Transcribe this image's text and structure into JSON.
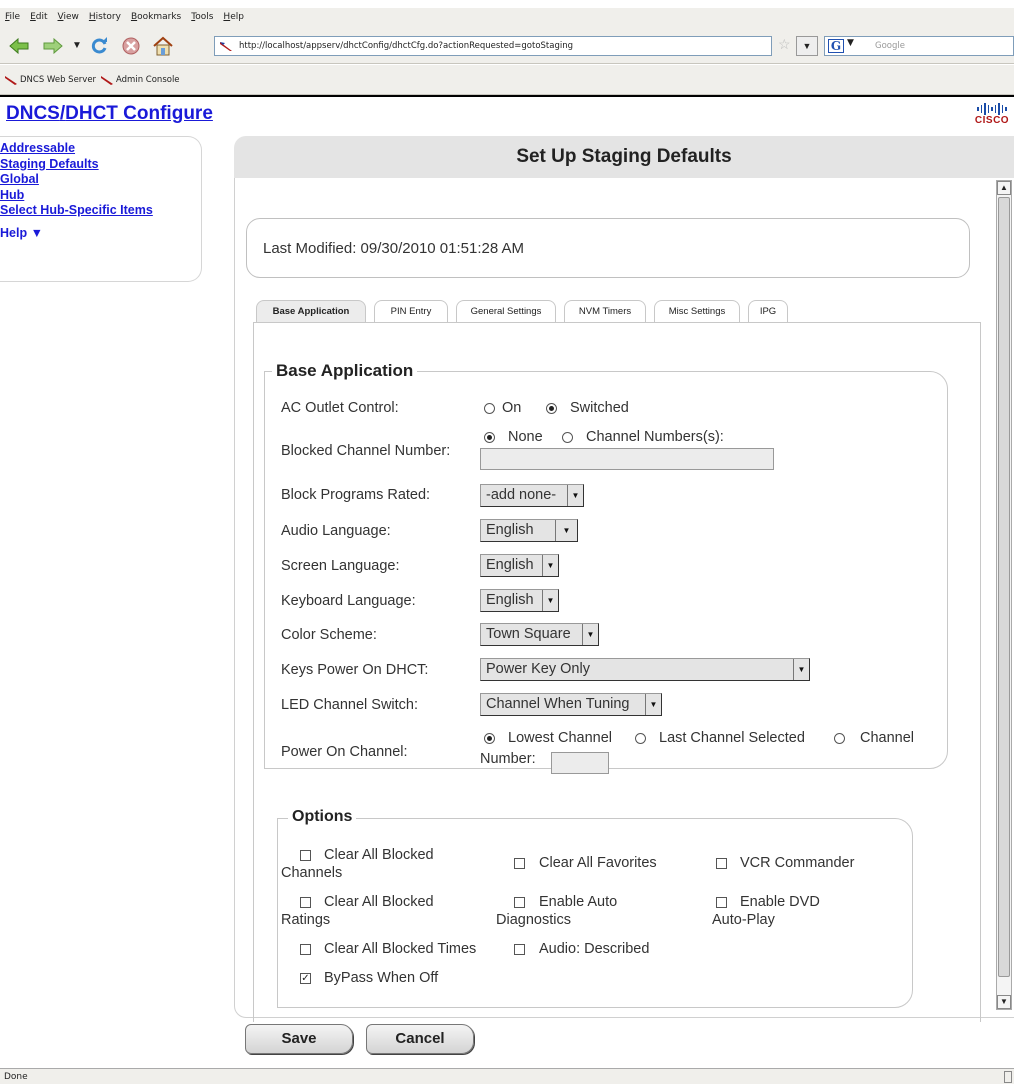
{
  "browser": {
    "menu": [
      "File",
      "Edit",
      "View",
      "History",
      "Bookmarks",
      "Tools",
      "Help"
    ],
    "url": "http://localhost/appserv/dhctConfig/dhctCfg.do?actionRequested=gotoStaging",
    "search_placeholder": "Google",
    "search_engine_letter": "G",
    "bookmarks": [
      "DNCS Web Server",
      "Admin Console"
    ],
    "status": "Done"
  },
  "app": {
    "title_part1": "DNCS",
    "title_sep": "/",
    "title_part2": "DHCT Configure",
    "logo_text": "CISCO"
  },
  "sidebar": {
    "items": [
      "Addressable",
      "Staging Defaults",
      "Global",
      "Hub",
      "Select Hub-Specific Items"
    ],
    "help_label": "Help",
    "help_arrow": "▼"
  },
  "page": {
    "title": "Set Up Staging Defaults",
    "last_modified": "Last Modified: 09/30/2010 01:51:28 AM"
  },
  "tabs": [
    {
      "label": "Base Application",
      "active": true
    },
    {
      "label": "PIN Entry",
      "active": false
    },
    {
      "label": "General Settings",
      "active": false
    },
    {
      "label": "NVM Timers",
      "active": false
    },
    {
      "label": "Misc Settings",
      "active": false
    },
    {
      "label": "IPG",
      "active": false
    }
  ],
  "base_application": {
    "legend": "Base Application",
    "ac_outlet": {
      "label": "AC Outlet Control:",
      "options": [
        "On",
        "Switched"
      ],
      "selected": "Switched"
    },
    "blocked_channel": {
      "label": "Blocked Channel Number:",
      "options": [
        "None",
        "Channel Numbers(s):"
      ],
      "selected": "None",
      "value": ""
    },
    "block_programs": {
      "label": "Block Programs Rated:",
      "value": "-add none-"
    },
    "audio_language": {
      "label": "Audio Language:",
      "value": "English"
    },
    "screen_language": {
      "label": "Screen Language:",
      "value": "English"
    },
    "keyboard_language": {
      "label": "Keyboard Language:",
      "value": "English"
    },
    "color_scheme": {
      "label": "Color Scheme:",
      "value": "Town Square"
    },
    "keys_power": {
      "label": "Keys Power On DHCT:",
      "value": "Power Key Only"
    },
    "led_channel": {
      "label": "LED Channel Switch:",
      "value": "Channel When Tuning"
    },
    "power_on_channel": {
      "label": "Power On Channel:",
      "options": [
        "Lowest Channel",
        "Last Channel Selected",
        "Channel"
      ],
      "number_label": "Number:",
      "selected": "Lowest Channel",
      "value": ""
    }
  },
  "options": {
    "legend": "Options",
    "items": [
      {
        "label_line1": "Clear All Blocked",
        "label_line2": "Channels",
        "checked": false
      },
      {
        "label_line1": "Clear All Favorites",
        "label_line2": "",
        "checked": false
      },
      {
        "label_line1": "VCR Commander",
        "label_line2": "",
        "checked": false
      },
      {
        "label_line1": "Clear All Blocked",
        "label_line2": "Ratings",
        "checked": false
      },
      {
        "label_line1": "Enable Auto",
        "label_line2": "Diagnostics",
        "checked": false
      },
      {
        "label_line1": "Enable DVD",
        "label_line2": "Auto-Play",
        "checked": false
      },
      {
        "label_line1": "Clear All Blocked Times",
        "label_line2": "",
        "checked": false
      },
      {
        "label_line1": "Audio: Described",
        "label_line2": "",
        "checked": false
      },
      {
        "label_line1": "ByPass When Off",
        "label_line2": "",
        "checked": true
      }
    ]
  },
  "buttons": {
    "save": "Save",
    "cancel": "Cancel"
  },
  "colors": {
    "link": "#1a1ad8",
    "header_band": "#e4e4e4",
    "cisco_red": "#b01818",
    "cisco_blue": "#1a4ca8"
  }
}
